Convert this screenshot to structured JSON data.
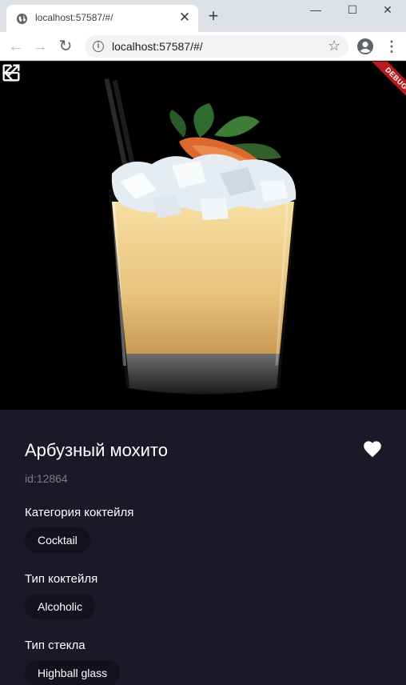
{
  "browser": {
    "tab_title": "localhost:57587/#/",
    "url": "localhost:57587/#/",
    "tab_close_glyph": "✕",
    "new_tab_glyph": "+",
    "min_glyph": "—",
    "max_glyph": "☐",
    "close_glyph": "✕"
  },
  "app": {
    "debug_banner": "DEBUG",
    "drink": {
      "name": "Арбузный мохито",
      "id_text": "id:12864",
      "is_favorite": true
    },
    "sections": [
      {
        "label": "Категория коктейля",
        "chip": "Cocktail"
      },
      {
        "label": "Тип коктейля",
        "chip": "Alcoholic"
      },
      {
        "label": "Тип стекла",
        "chip": "Highball glass"
      }
    ]
  },
  "icons": {
    "back": "arrow-back-icon",
    "edit": "open-in-new-icon",
    "favorite": "heart-icon"
  },
  "colors": {
    "background": "#1a1927",
    "chip": "#12111c",
    "muted_text": "#7d7c86",
    "debug_banner": "#b71c1c"
  }
}
